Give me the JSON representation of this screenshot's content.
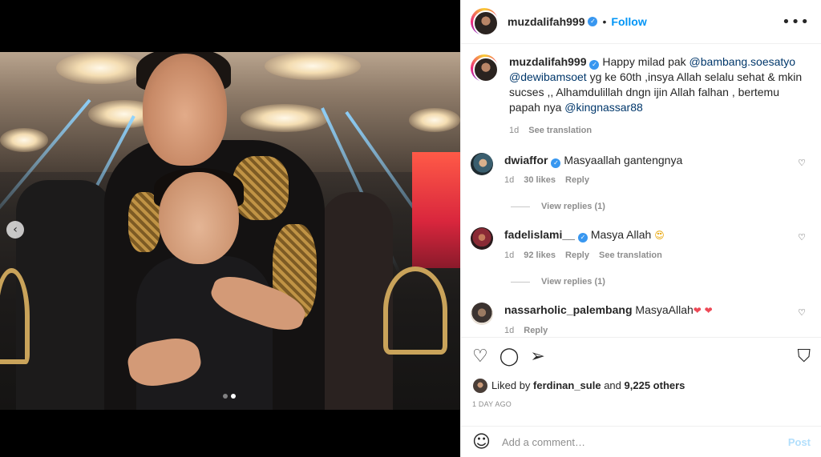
{
  "post": {
    "username": "muzdalifah999",
    "separator": "•",
    "follow_label": "Follow",
    "more_icon": "more-options-icon",
    "carousel": {
      "prev_icon": "chevron-left-icon",
      "total": 2,
      "current": 2
    }
  },
  "caption": {
    "username": "muzdalifah999",
    "text_1": "Happy milad pak ",
    "mention_1": "@bambang.soesatyo",
    "mention_2": "@dewibamsoet",
    "text_2": " yg ke 60th ,insya Allah selalu sehat & mkin sucses ,, Alhamdulillah dngn ijin Allah falhan , bertemu papah nya ",
    "mention_3": "@kingnassar88",
    "time": "1d",
    "translate": "See translation"
  },
  "comments": [
    {
      "username": "dwiaffor",
      "verified": true,
      "text": "Masyaallah gantengnya",
      "time": "1d",
      "likes": "30 likes",
      "reply": "Reply",
      "view_replies": "View replies (1)"
    },
    {
      "username": "fadelislami__",
      "verified": true,
      "text": "Masya Allah",
      "emoji": "😍",
      "time": "1d",
      "likes": "92 likes",
      "reply": "Reply",
      "translate": "See translation",
      "view_replies": "View replies (1)"
    },
    {
      "username": "nassarholic_palembang",
      "verified": false,
      "text": "MasyaAllah",
      "emoji": "❤ ❤",
      "time": "1d",
      "reply": "Reply"
    }
  ],
  "actions": {
    "like_icon": "heart-icon",
    "comment_icon": "comment-icon",
    "share_icon": "share-icon",
    "save_icon": "bookmark-icon",
    "liked_prefix": "Liked by ",
    "liked_user": "ferdinan_sule",
    "liked_mid": " and ",
    "liked_others": "9,225 others",
    "ago": "1 DAY AGO"
  },
  "add_comment": {
    "placeholder": "Add a comment…",
    "post_label": "Post"
  },
  "colors": {
    "link": "#0095f6",
    "mention": "#00376b",
    "muted": "#8e8e8e"
  }
}
